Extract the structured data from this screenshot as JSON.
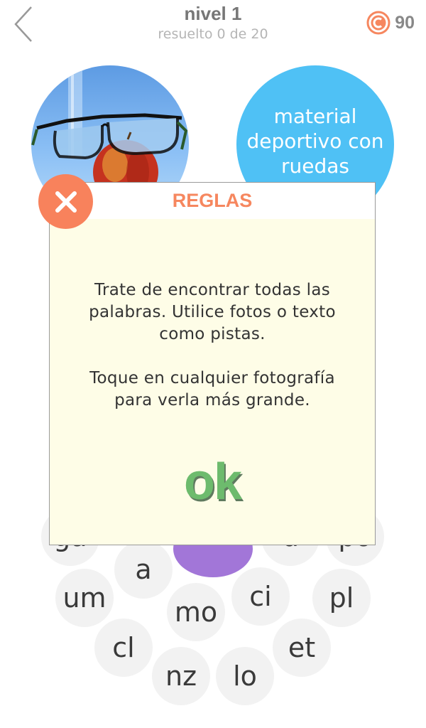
{
  "header": {
    "title": "nivel 1",
    "subtitle": "resuelto 0 de 20",
    "coins": "90"
  },
  "hints": {
    "text_hint": "material deportivo con ruedas"
  },
  "letters": [
    {
      "text": "ga"
    },
    {
      "text": "a"
    },
    {
      "text": ""
    },
    {
      "text": "u"
    },
    {
      "text": "po"
    },
    {
      "text": "um"
    },
    {
      "text": "mo"
    },
    {
      "text": "ci"
    },
    {
      "text": "pl"
    },
    {
      "text": "cl"
    },
    {
      "text": "et"
    },
    {
      "text": "nz"
    },
    {
      "text": "lo"
    }
  ],
  "dialog": {
    "title": "REGLAS",
    "paragraph1": "Trate de encontrar todas las palabras. Utilice fotos o texto como pistas.",
    "paragraph2": "Toque en cualquier fotografía para verla más grande.",
    "ok_label": "ok"
  },
  "colors": {
    "accent": "#f6875f",
    "hint_circle": "#4fc1f5",
    "ok_green": "#6dbb6d",
    "dialog_bg": "#fefde7"
  }
}
